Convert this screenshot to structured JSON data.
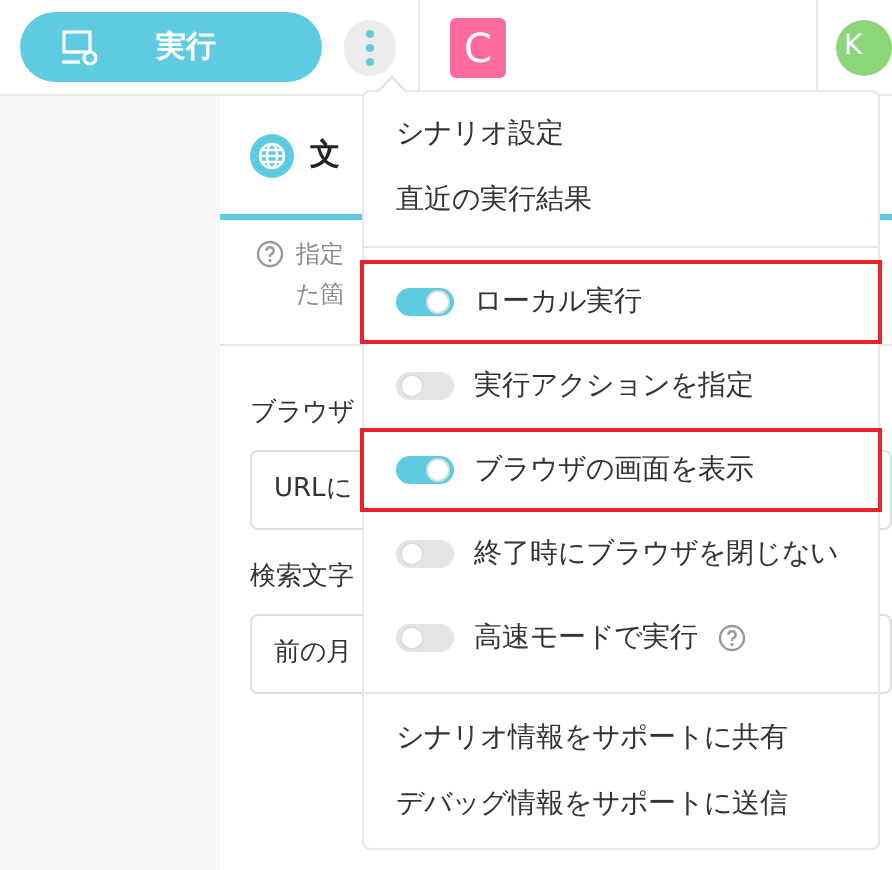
{
  "toolbar": {
    "run_button": "実行",
    "project_badge": "C",
    "avatar": "K"
  },
  "panel": {
    "tab": "文",
    "help_lines": [
      "指定",
      "た箇"
    ],
    "fields": [
      {
        "label": "ブラウザ",
        "value": "URLに"
      },
      {
        "label": "検索文字",
        "value": "前の月"
      }
    ]
  },
  "menu": {
    "items": [
      {
        "kind": "link",
        "label": "シナリオ設定"
      },
      {
        "kind": "link",
        "label": "直近の実行結果"
      },
      {
        "kind": "divider"
      },
      {
        "kind": "toggle",
        "label": "ローカル実行",
        "on": true,
        "highlighted": true
      },
      {
        "kind": "toggle",
        "label": "実行アクションを指定",
        "on": false,
        "highlighted": false
      },
      {
        "kind": "toggle",
        "label": "ブラウザの画面を表示",
        "on": true,
        "highlighted": true
      },
      {
        "kind": "toggle",
        "label": "終了時にブラウザを閉じない",
        "on": false,
        "highlighted": false
      },
      {
        "kind": "toggle",
        "label": "高速モードで実行",
        "on": false,
        "highlighted": false,
        "help": true
      },
      {
        "kind": "divider"
      },
      {
        "kind": "link",
        "label": "シナリオ情報をサポートに共有"
      },
      {
        "kind": "link",
        "label": "デバッグ情報をサポートに送信"
      }
    ]
  }
}
